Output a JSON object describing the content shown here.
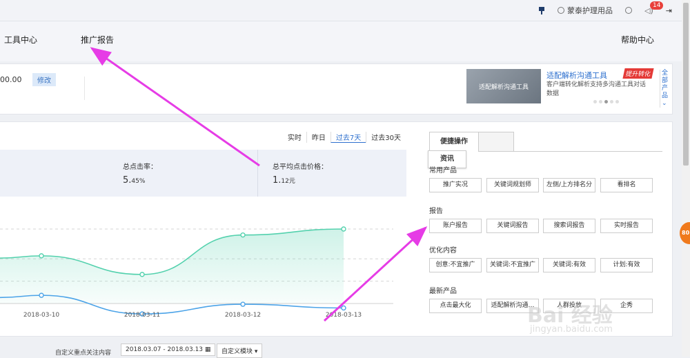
{
  "topbar": {
    "user": "蒙泰护理用品",
    "badge": "14"
  },
  "nav": {
    "tools": "工具中心",
    "report": "推广报告",
    "help": "帮助中心"
  },
  "account": {
    "balance": "00.00",
    "edit": "修改"
  },
  "promo": {
    "image_text": "适配解析沟通工具",
    "title": "适配解析沟通工具",
    "tag": "提升转化",
    "desc": "客户端转化解析支持多沟通工具对话数据",
    "all": "全部产品"
  },
  "timefilter": [
    "实时",
    "昨日",
    "过去7天",
    "过去30天"
  ],
  "stats": {
    "ctr_label": "总点击率：",
    "ctr_int": "5.",
    "ctr_dec": "45%",
    "cpc_label": "总平均点击价格：",
    "cpc_int": "1.",
    "cpc_dec": "12元"
  },
  "chart_data": {
    "type": "line",
    "x": [
      "2018-03-10",
      "2018-03-11",
      "2018-03-12",
      "2018-03-13"
    ],
    "series": [
      {
        "color": "#53d1ad",
        "values": [
          0.64,
          0.39,
          0.92,
          1.0
        ]
      },
      {
        "color": "#4ba3e8",
        "values": [
          0.11,
          -0.14,
          -0.01,
          -0.06
        ]
      }
    ],
    "area": true,
    "grid": true
  },
  "quick": {
    "tab1": "便捷操作",
    "tooltip": "资讯",
    "sections": [
      {
        "title": "常用产品",
        "items": [
          "推广实况",
          "关键词规划师",
          "左侧/上方排名分",
          "看排名"
        ]
      },
      {
        "title": "报告",
        "items": [
          "账户报告",
          "关键词报告",
          "搜索词报告",
          "实时报告"
        ]
      },
      {
        "title": "优化内容",
        "items": [
          "创意:不宜推广",
          "关键词:不宜推广",
          "关键词:有效",
          "计划:有效"
        ]
      },
      {
        "title": "最新产品",
        "items": [
          "点击最大化",
          "适配解析沟通…",
          "人群投放",
          "企秀"
        ]
      }
    ]
  },
  "footer": {
    "label": "自定义重点关注内容",
    "range": "2018.03.07 - 2018.03.13",
    "module": "自定义模块"
  },
  "side": {
    "bubble": "80"
  },
  "watermark": {
    "main": "Bai 经验",
    "sub": "jingyan.baidu.com"
  }
}
